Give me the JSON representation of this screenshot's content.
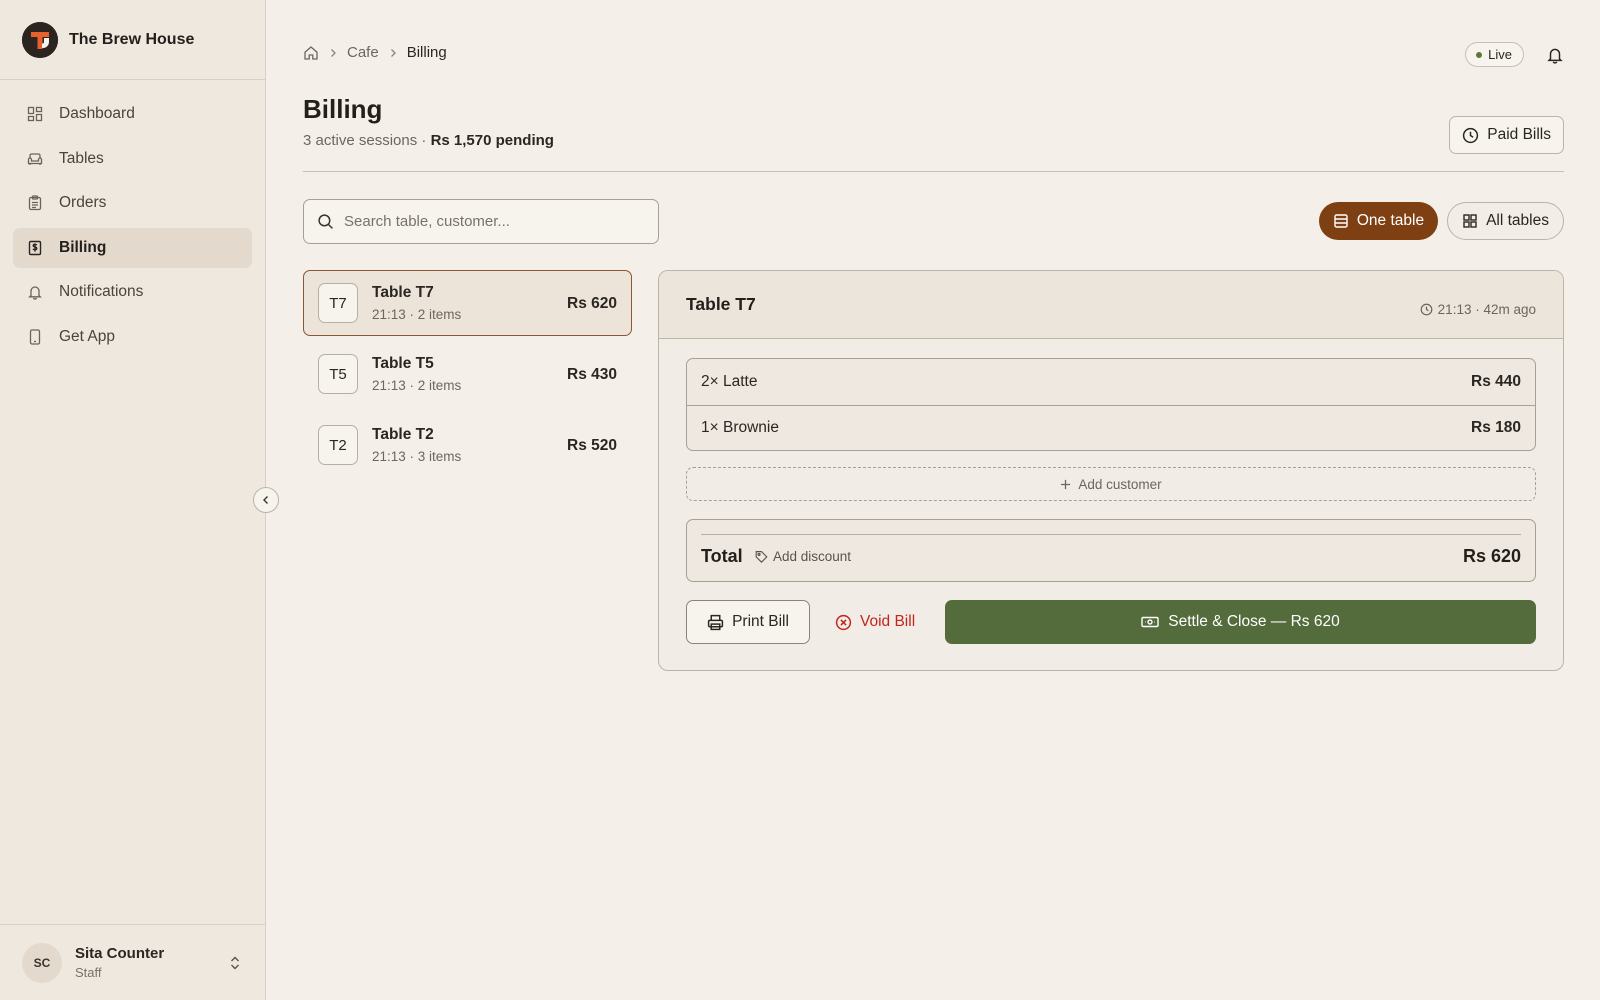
{
  "brand": {
    "name": "The Brew House"
  },
  "sidebar": {
    "items": [
      {
        "label": "Dashboard",
        "icon": "dashboard-grid-icon"
      },
      {
        "label": "Tables",
        "icon": "armchair-icon"
      },
      {
        "label": "Orders",
        "icon": "clipboard-list-icon"
      },
      {
        "label": "Billing",
        "icon": "receipt-dollar-icon",
        "active": true
      },
      {
        "label": "Notifications",
        "icon": "bell-icon"
      },
      {
        "label": "Get App",
        "icon": "smartphone-icon"
      }
    ]
  },
  "user": {
    "initials": "SC",
    "name": "Sita Counter",
    "role": "Staff"
  },
  "breadcrumb": {
    "section": "Cafe",
    "current": "Billing"
  },
  "status": {
    "live_label": "Live",
    "live_color": "#5a7a3a"
  },
  "header": {
    "title": "Billing",
    "sessions": "3 active sessions",
    "separator": " · ",
    "pending": "Rs 1,570 pending",
    "paid_bills_label": "Paid Bills"
  },
  "search": {
    "placeholder": "Search table, customer..."
  },
  "view_toggle": {
    "one_table": "One table",
    "all_tables": "All tables",
    "selected": "one_table"
  },
  "tables": [
    {
      "code": "T7",
      "name": "Table T7",
      "meta": "21:13 · 2 items",
      "amount": "Rs 620",
      "selected": true
    },
    {
      "code": "T5",
      "name": "Table T5",
      "meta": "21:13 · 2 items",
      "amount": "Rs 430"
    },
    {
      "code": "T2",
      "name": "Table T2",
      "meta": "21:13 · 3 items",
      "amount": "Rs 520"
    }
  ],
  "detail": {
    "title": "Table T7",
    "time": "21:13 · 42m ago",
    "lines": [
      {
        "item": "2× Latte",
        "price": "Rs 440"
      },
      {
        "item": "1× Brownie",
        "price": "Rs 180"
      }
    ],
    "add_customer_label": "Add customer",
    "total_label": "Total",
    "add_discount_label": "Add discount",
    "total_value": "Rs 620",
    "print_label": "Print Bill",
    "void_label": "Void Bill",
    "settle_label": "Settle & Close — Rs 620"
  },
  "colors": {
    "accent_brown": "#7e3f12",
    "settle_green": "#546b3c",
    "void_red": "#c0271d",
    "logo_orange": "#e8602c"
  }
}
